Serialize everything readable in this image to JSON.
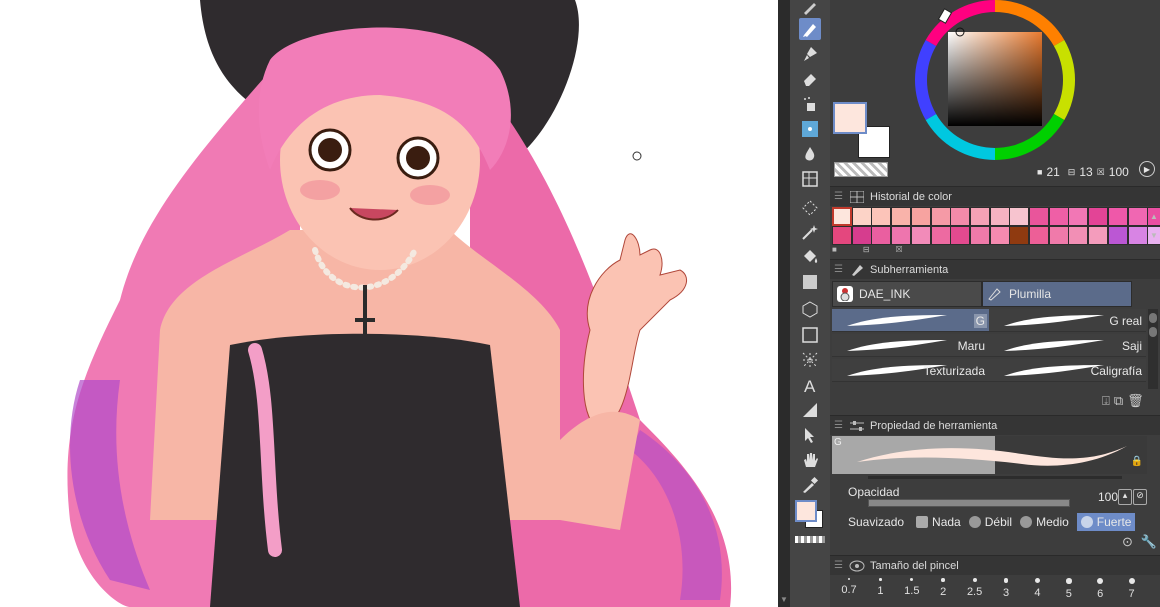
{
  "colors": {
    "main_color": "#fde6dd",
    "sub_color": "#ffffff",
    "accent": "#6e8cc8"
  },
  "color_wheel": {
    "values": {
      "h": "21",
      "s": "13",
      "v": "100"
    },
    "h_icon": "h-icon",
    "s_icon": "s-icon",
    "v_icon": "v-icon"
  },
  "color_history": {
    "title": "Historial de color",
    "swatches": [
      "#fde6dd",
      "#fcd3c7",
      "#fcc4b9",
      "#f9b3aa",
      "#f7a3a0",
      "#f59aa6",
      "#f38ba9",
      "#f5a2b6",
      "#f6b3c2",
      "#f7c4cf",
      "#e9559b",
      "#ef5fa6",
      "#f277b5",
      "#e34496",
      "#ef58a9",
      "#f067b2",
      "#ea4fa2",
      "#e4477e",
      "#d63d8e",
      "#ea5fa0",
      "#ee75ae",
      "#f28bb9",
      "#ed6aa1",
      "#e34a8f",
      "#ef7aa9",
      "#f58ab0",
      "#8f3a10",
      "#ed5f97",
      "#f07aaa",
      "#f28fb5",
      "#f49cbc",
      "#bb57d4",
      "#d884e4",
      "#e9b2f0"
    ]
  },
  "subtool": {
    "title": "Subherramienta",
    "group_1": "DAE_INK",
    "group_2": "Plumilla",
    "brushes": [
      {
        "label": "G"
      },
      {
        "label": "G real"
      },
      {
        "label": "Maru"
      },
      {
        "label": "Saji"
      },
      {
        "label": "Texturizada"
      },
      {
        "label": "Caligrafía"
      }
    ]
  },
  "tool_property": {
    "title": "Propiedad de herramienta",
    "preview_label": "G",
    "opacity_label": "Opacidad",
    "opacity_value": "100",
    "opacity": 1.0,
    "smoothing_label": "Suavizado",
    "smoothing_options": [
      "Nada",
      "Débil",
      "Medio",
      "Fuerte"
    ],
    "smoothing_selected": "Fuerte"
  },
  "brush_size": {
    "title": "Tamaño del pincel",
    "sizes": [
      "0.7",
      "1",
      "1.5",
      "2",
      "2.5",
      "3",
      "4",
      "5",
      "6",
      "7"
    ]
  }
}
